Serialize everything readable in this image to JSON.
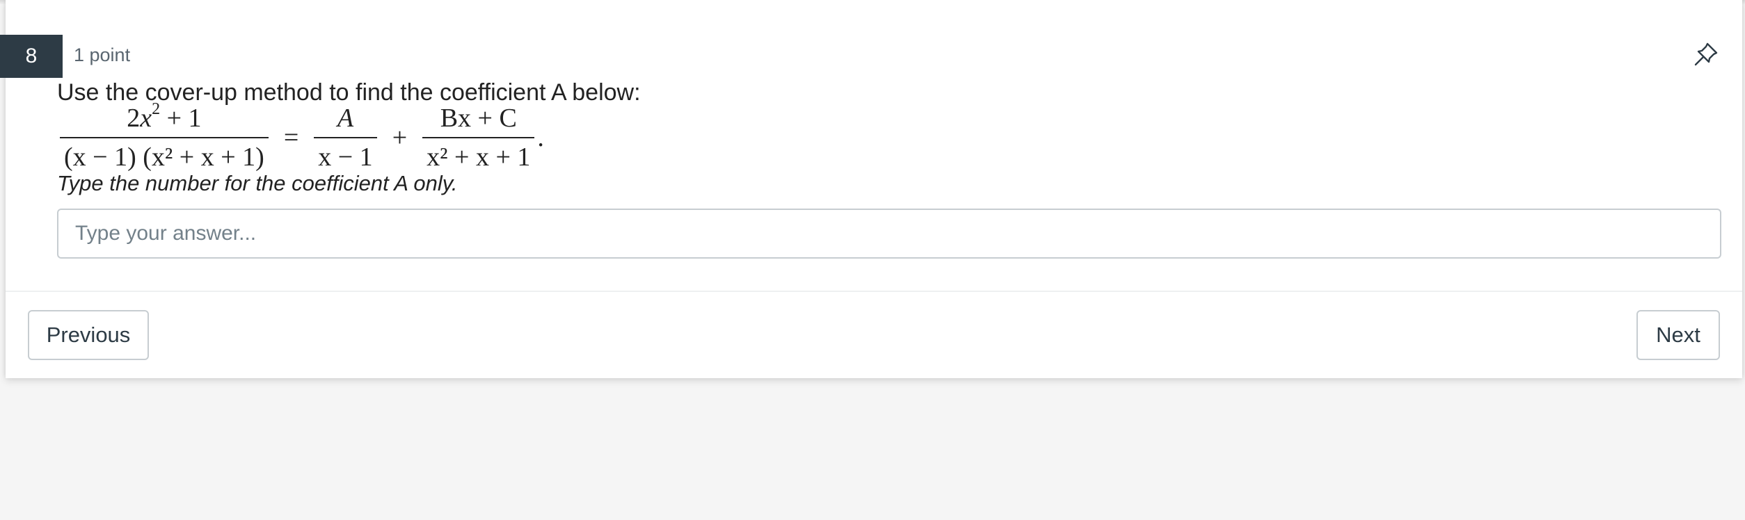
{
  "question": {
    "number": "8",
    "points": "1 point",
    "prompt": "Use the cover-up method to find the coefficient A below:",
    "hint": "Type the number for the coefficient A only.",
    "pin_icon": "pin-icon"
  },
  "equation": {
    "lhs_num_a": "2",
    "lhs_num_var": "x",
    "lhs_num_exp": "2",
    "lhs_num_tail": " + 1",
    "lhs_den": "(x − 1) (x² + x + 1)",
    "equals": "=",
    "t1_num": "A",
    "t1_den": "x − 1",
    "plus": "+",
    "t2_num": "Bx + C",
    "t2_den": "x² + x + 1",
    "period": "."
  },
  "answer": {
    "placeholder": "Type your answer...",
    "value": ""
  },
  "nav": {
    "previous_label": "Previous",
    "next_label": "Next"
  }
}
